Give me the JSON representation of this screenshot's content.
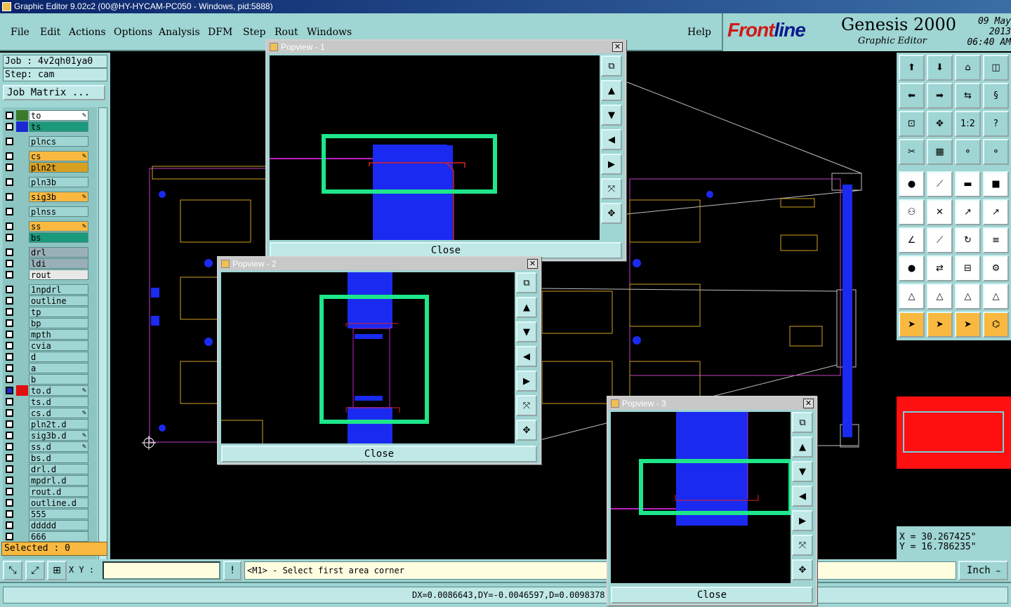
{
  "window": {
    "title": "Graphic Editor 9.02c2 (00@HY-HYCAM-PC050 - Windows, pid:5888)"
  },
  "menu": [
    "File",
    "Edit",
    "Actions",
    "Options",
    "Analysis",
    "DFM",
    "Step",
    "Rout",
    "Windows"
  ],
  "help": "Help",
  "brand": {
    "logo_front": "Front",
    "logo_line": "line",
    "product": "Genesis 2000",
    "subtitle": "Graphic Editor",
    "date": "09 May 2013",
    "time": "06:40 AM"
  },
  "job": {
    "job_label": "Job : 4v2qh01ya0",
    "step_label": "Step: cam",
    "matrix_button": "Job Matrix ..."
  },
  "layers": [
    {
      "name": "to",
      "color": "#ffffff",
      "swatch": "#3a7a2a",
      "edit": true
    },
    {
      "name": "ts",
      "color": "#1a9a7a",
      "swatch": "#1a2ad0",
      "edit": false
    },
    {
      "name": "plncs",
      "color": "#9fd5d3",
      "swatch": "",
      "edit": false
    },
    {
      "name": "cs",
      "color": "#f9b940",
      "swatch": "",
      "edit": true
    },
    {
      "name": "pln2t",
      "color": "#d8a020",
      "swatch": "",
      "edit": false
    },
    {
      "name": "pln3b",
      "color": "#9fd5d3",
      "swatch": "",
      "edit": false
    },
    {
      "name": "sig3b",
      "color": "#f9b940",
      "swatch": "",
      "edit": true
    },
    {
      "name": "plnss",
      "color": "#9fd5d3",
      "swatch": "",
      "edit": false
    },
    {
      "name": "ss",
      "color": "#f9b940",
      "swatch": "",
      "edit": true
    },
    {
      "name": "bs",
      "color": "#1a9a7a",
      "swatch": "",
      "edit": false
    },
    {
      "name": "drl",
      "color": "#9ab0b8",
      "swatch": "",
      "edit": false
    },
    {
      "name": "ldi",
      "color": "#9ab0b8",
      "swatch": "",
      "edit": false
    },
    {
      "name": "rout",
      "color": "#e8e8e8",
      "swatch": "",
      "edit": false
    },
    {
      "name": "1npdrl",
      "color": "#9fd5d3",
      "swatch": "",
      "edit": false
    },
    {
      "name": "outline",
      "color": "#9fd5d3",
      "swatch": "",
      "edit": false
    },
    {
      "name": "tp",
      "color": "#9fd5d3",
      "swatch": "",
      "edit": false
    },
    {
      "name": "bp",
      "color": "#9fd5d3",
      "swatch": "",
      "edit": false
    },
    {
      "name": "mpth",
      "color": "#9fd5d3",
      "swatch": "",
      "edit": false
    },
    {
      "name": "cvia",
      "color": "#9fd5d3",
      "swatch": "",
      "edit": false
    },
    {
      "name": "d",
      "color": "#9fd5d3",
      "swatch": "",
      "edit": false
    },
    {
      "name": "a",
      "color": "#9fd5d3",
      "swatch": "",
      "edit": false
    },
    {
      "name": "b",
      "color": "#9fd5d3",
      "swatch": "",
      "edit": false
    },
    {
      "name": "to.d",
      "color": "#9fd5d3",
      "swatch": "#e01010",
      "edit": true
    },
    {
      "name": "ts.d",
      "color": "#9fd5d3",
      "swatch": "",
      "edit": false
    },
    {
      "name": "cs.d",
      "color": "#9fd5d3",
      "swatch": "",
      "edit": true
    },
    {
      "name": "pln2t.d",
      "color": "#9fd5d3",
      "swatch": "",
      "edit": false
    },
    {
      "name": "sig3b.d",
      "color": "#9fd5d3",
      "swatch": "",
      "edit": true
    },
    {
      "name": "ss.d",
      "color": "#9fd5d3",
      "swatch": "",
      "edit": true
    },
    {
      "name": "bs.d",
      "color": "#9fd5d3",
      "swatch": "",
      "edit": false
    },
    {
      "name": "drl.d",
      "color": "#9fd5d3",
      "swatch": "",
      "edit": false
    },
    {
      "name": "mpdrl.d",
      "color": "#9fd5d3",
      "swatch": "",
      "edit": false
    },
    {
      "name": "rout.d",
      "color": "#9fd5d3",
      "swatch": "",
      "edit": false
    },
    {
      "name": "outline.d",
      "color": "#9fd5d3",
      "swatch": "",
      "edit": false
    },
    {
      "name": "555",
      "color": "#9fd5d3",
      "swatch": "",
      "edit": false
    },
    {
      "name": "ddddd",
      "color": "#9fd5d3",
      "swatch": "",
      "edit": false
    },
    {
      "name": "666",
      "color": "#9fd5d3",
      "swatch": "",
      "edit": false
    }
  ],
  "selected": "Selected : 0",
  "coords": {
    "x": "X  = 30.267425\"",
    "y": "Y  = 16.786235\""
  },
  "bottom": {
    "xy_label": "X Y :",
    "prompt": "<M1> - Select first area corner",
    "unit": "Inch"
  },
  "status": "DX=0.0086643,DY=-0.0046597,D=0.0098378",
  "popups": [
    {
      "title": "Popview - 1",
      "close": "Close"
    },
    {
      "title": "Popview - 2",
      "close": "Close"
    },
    {
      "title": "Popview - 3",
      "close": "Close"
    }
  ],
  "colors": {
    "panel": "#9fd5d3",
    "highlight": "#1ee68a",
    "pad_blue": "#1a2af0",
    "trace_yellow": "#d0a020",
    "outline_magenta": "#c040c0"
  }
}
